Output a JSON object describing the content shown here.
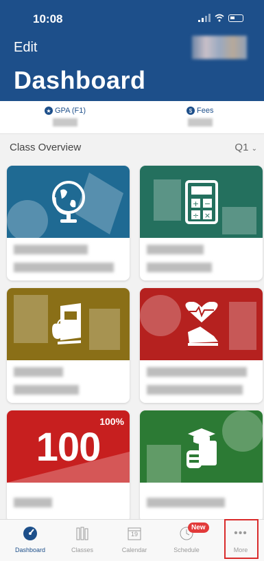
{
  "status": {
    "time": "10:08"
  },
  "header": {
    "edit_label": "Edit",
    "title": "Dashboard"
  },
  "summary": {
    "gpa_label": "GPA (F1)",
    "fees_label": "Fees"
  },
  "overview": {
    "title": "Class Overview",
    "term": "Q1"
  },
  "cards": [
    {
      "subject_icon": "globe-icon",
      "color": "#1f6a93"
    },
    {
      "subject_icon": "calculator-icon",
      "color": "#24705e"
    },
    {
      "subject_icon": "book-apple-icon",
      "color": "#8a6f17"
    },
    {
      "subject_icon": "heart-shoe-icon",
      "color": "#b5211f"
    },
    {
      "subject_icon": "score-100-icon",
      "color": "#c71f1f",
      "big_text": "100",
      "percent_text": "100%"
    },
    {
      "subject_icon": "books-graduation-icon",
      "color": "#2c7a34"
    }
  ],
  "tabs": [
    {
      "label": "Dashboard",
      "icon": "dashboard-icon",
      "active": true
    },
    {
      "label": "Classes",
      "icon": "classes-icon"
    },
    {
      "label": "Calendar",
      "icon": "calendar-icon",
      "day": "19"
    },
    {
      "label": "Schedule",
      "icon": "schedule-icon",
      "badge": "New"
    },
    {
      "label": "More",
      "icon": "more-icon"
    }
  ],
  "colors": {
    "brand": "#1d4f8a",
    "highlight": "#d92a2a"
  }
}
